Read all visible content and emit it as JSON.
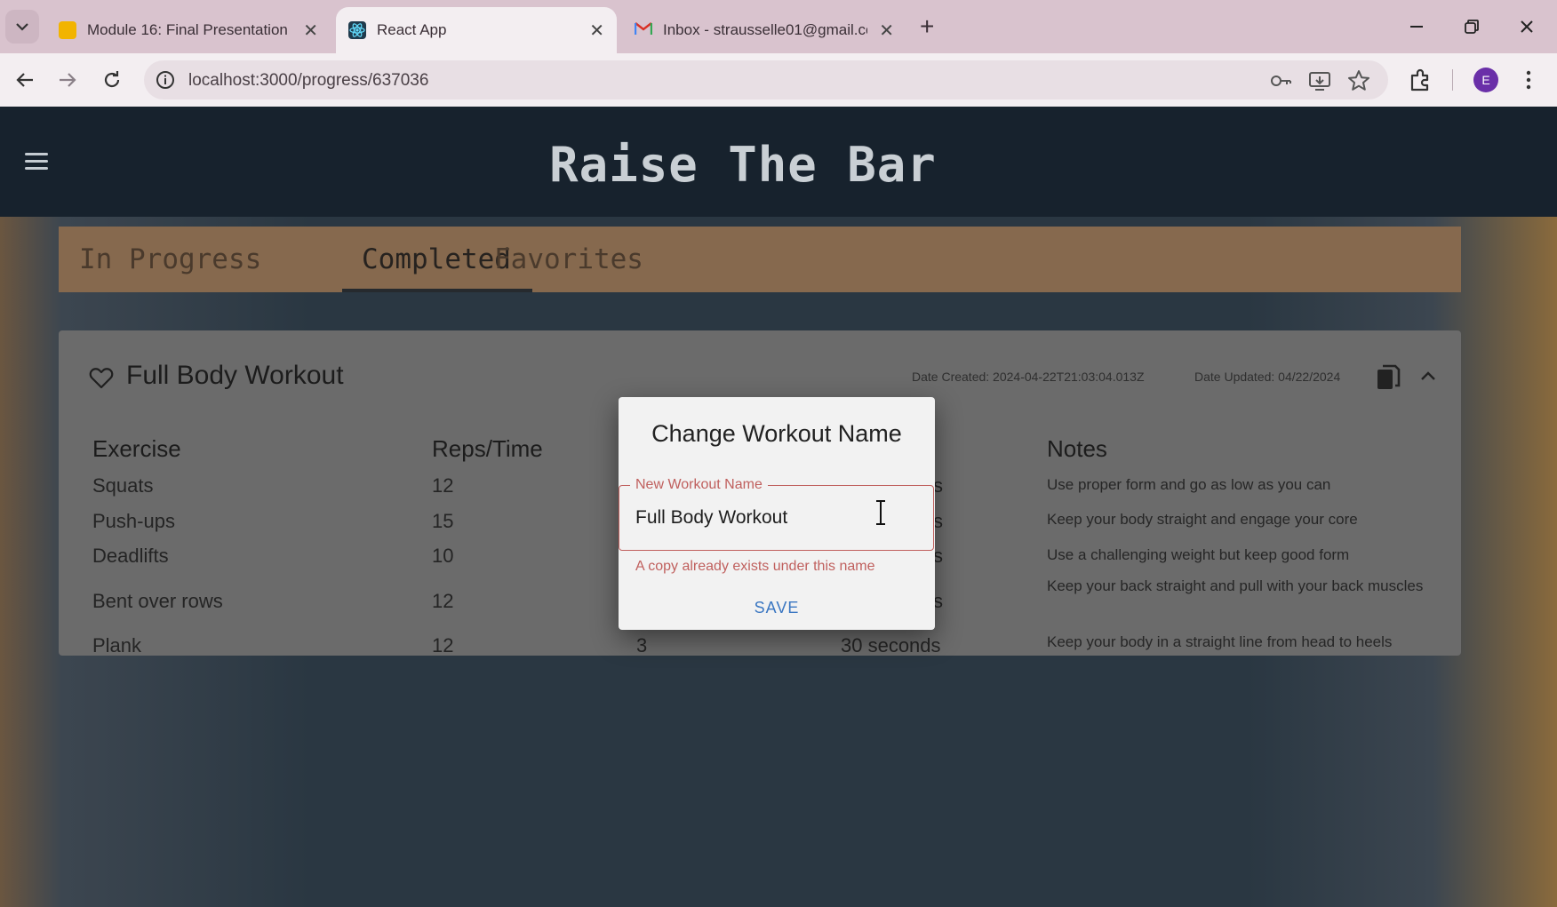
{
  "browser": {
    "tabs": [
      {
        "title": "Module 16: Final Presentation",
        "icon": "slides-icon",
        "active": false
      },
      {
        "title": "React App",
        "icon": "react-icon",
        "active": true
      },
      {
        "title": "Inbox - strausselle01@gmail.co",
        "icon": "gmail-icon",
        "active": false
      }
    ],
    "url": "localhost:3000/progress/637036",
    "profile_initial": "E"
  },
  "app": {
    "title": "Raise The Bar",
    "tabs": [
      "In Progress",
      "Completed",
      "Favorites"
    ],
    "selected_tab": "Completed"
  },
  "workout": {
    "name": "Full Body Workout",
    "date_created": "Date Created: 2024-04-22T21:03:04.013Z",
    "date_updated": "Date Updated: 04/22/2024",
    "headers": {
      "exercise": "Exercise",
      "reps": "Reps/Time",
      "notes": "Notes"
    },
    "rows": [
      {
        "exercise": "Squats",
        "reps": "12",
        "sets": "",
        "duration": "s",
        "notes": "Use proper form and go as low as you can"
      },
      {
        "exercise": "Push-ups",
        "reps": "15",
        "sets": "",
        "duration": "s",
        "notes": "Keep your body straight and engage your core"
      },
      {
        "exercise": "Deadlifts",
        "reps": "10",
        "sets": "",
        "duration": "s",
        "notes": "Use a challenging weight but keep good form"
      },
      {
        "exercise": "Bent over rows",
        "reps": "12",
        "sets": "",
        "duration": "s",
        "notes": "Keep your back straight and pull with your back muscles"
      },
      {
        "exercise": "Plank",
        "reps": "12",
        "sets": "3",
        "duration": "30 seconds",
        "notes": "Keep your body in a straight line from head to heels"
      }
    ]
  },
  "modal": {
    "title": "Change Workout Name",
    "field_label": "New Workout Name",
    "field_value": "Full Body Workout",
    "error": "A copy already exists under this name",
    "save_label": "SAVE"
  },
  "colors": {
    "header_bg": "#17222d",
    "tabs_bar_bg": "#86694e",
    "error": "#c0605e",
    "save": "#3b77c2"
  }
}
